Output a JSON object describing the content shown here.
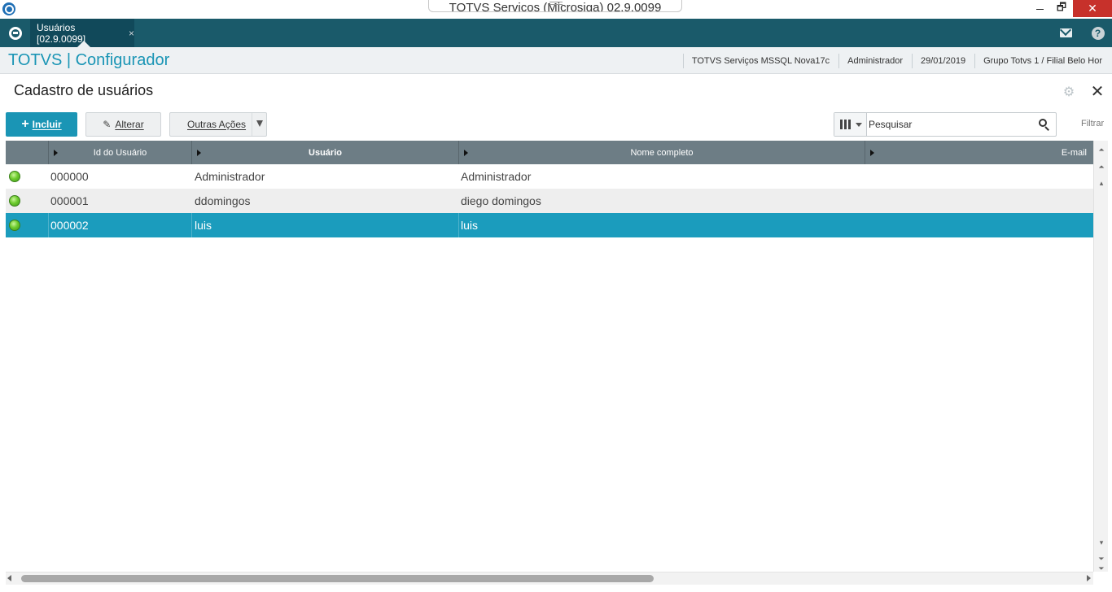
{
  "window": {
    "title": "TOTVS Serviços (Microsiga) 02.9.0099",
    "minimize": "",
    "maximize": "🗗",
    "close": "✕"
  },
  "topbar": {
    "tab_label": "Usuários [02.9.0099]",
    "tab_close": "×"
  },
  "subheader": {
    "module_title": "TOTVS | Configurador",
    "environment": "TOTVS Serviços MSSQL Nova17c",
    "user": "Administrador",
    "date": "29/01/2019",
    "branch": "Grupo Totvs 1 / Filial Belo Hor"
  },
  "page": {
    "title": "Cadastro de usuários",
    "close_glyph": "✕",
    "settings_glyph": "⚙"
  },
  "toolbar": {
    "include_label": "Incluir",
    "alter_label": "Alterar",
    "other_actions_label": "Outras Ações",
    "search_placeholder": "Pesquisar",
    "filter_label": "Filtrar"
  },
  "grid": {
    "columns": {
      "id": "Id do Usuário",
      "user": "Usuário",
      "full_name": "Nome completo",
      "email": "E-mail"
    },
    "rows": [
      {
        "id": "000000",
        "user": "Administrador",
        "full_name": "Administrador",
        "email": ""
      },
      {
        "id": "000001",
        "user": "ddomingos",
        "full_name": "diego domingos",
        "email": ""
      },
      {
        "id": "000002",
        "user": "luis",
        "full_name": "luis",
        "email": ""
      }
    ],
    "selected_row": 2
  },
  "colors": {
    "accent": "#1a95b5",
    "topbar": "#1a5a6a",
    "selected_row": "#1b9cbd",
    "status_active": "#6fcc2f"
  }
}
